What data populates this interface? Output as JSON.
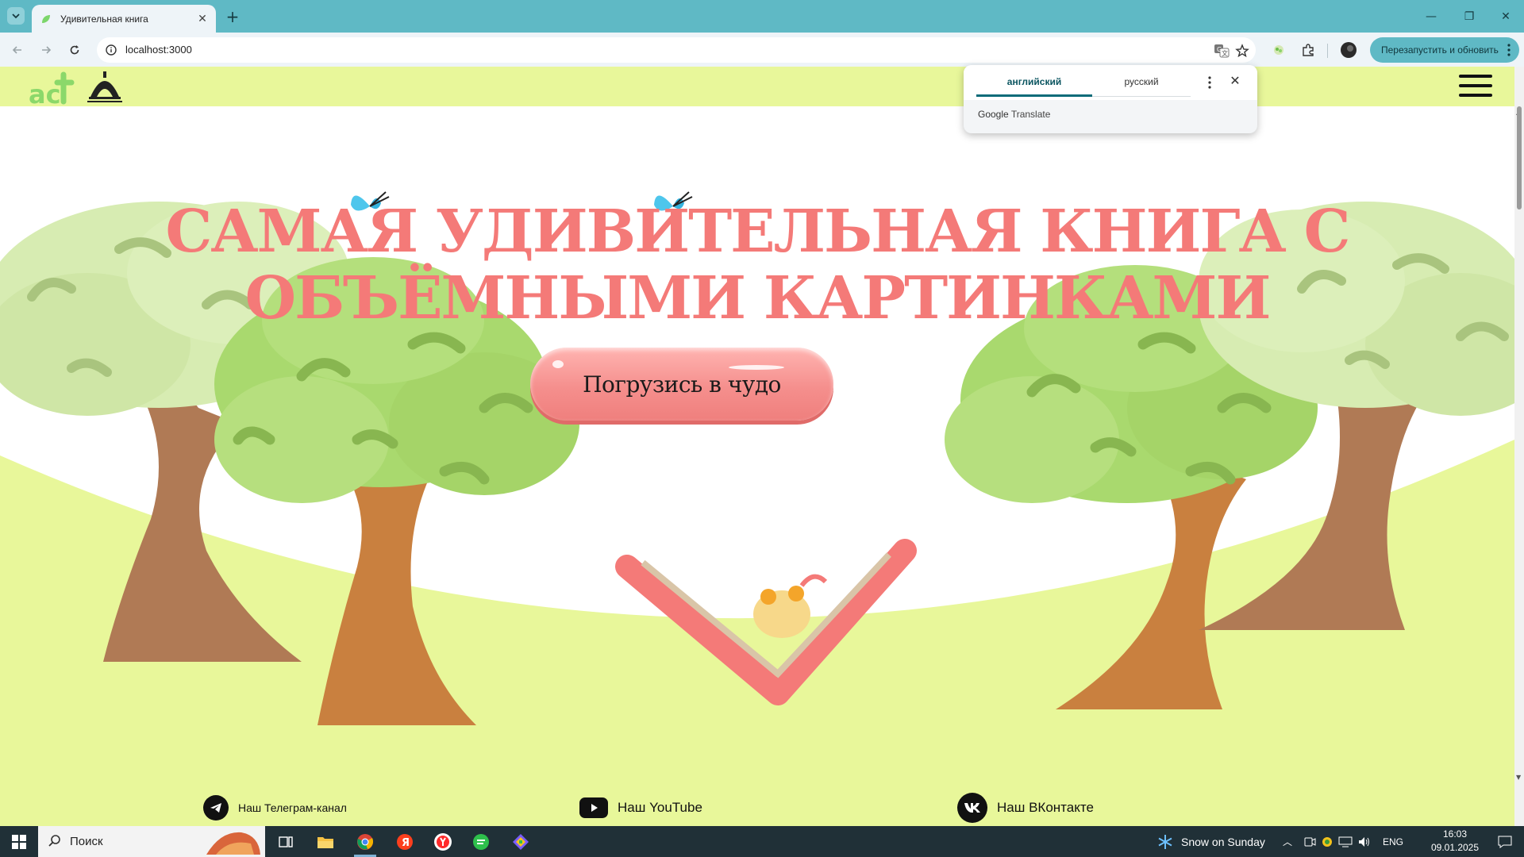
{
  "browser": {
    "tab_title": "Удивительная книга",
    "url": "localhost:3000",
    "relaunch_label": "Перезапустить и обновить"
  },
  "translate_popup": {
    "source_lang": "английский",
    "target_lang": "русский",
    "brand": "Google",
    "product": "Translate"
  },
  "site": {
    "headline_line1": "САМАЯ УДИВИТЕЛЬНАЯ КНИГА С",
    "headline_line2": "ОБЪЁМНЫМИ КАРТИНКАМИ",
    "cta_label": "Погрузись в чудо",
    "social": [
      {
        "label": "Наш Телеграм-канал",
        "icon": "telegram-icon"
      },
      {
        "label": "Наш YouTube",
        "icon": "youtube-icon"
      },
      {
        "label": "Наш ВКонтакте",
        "icon": "vk-icon"
      }
    ]
  },
  "taskbar": {
    "search_label": "Поиск",
    "weather_label": "Snow on Sunday",
    "lang": "ENG",
    "time": "16:03",
    "date": "09.01.2025"
  },
  "colors": {
    "chrome": "#5fb9c5",
    "site_green": "#e8f79a",
    "headline": "#f47a78",
    "cta": "#f58f8d"
  }
}
